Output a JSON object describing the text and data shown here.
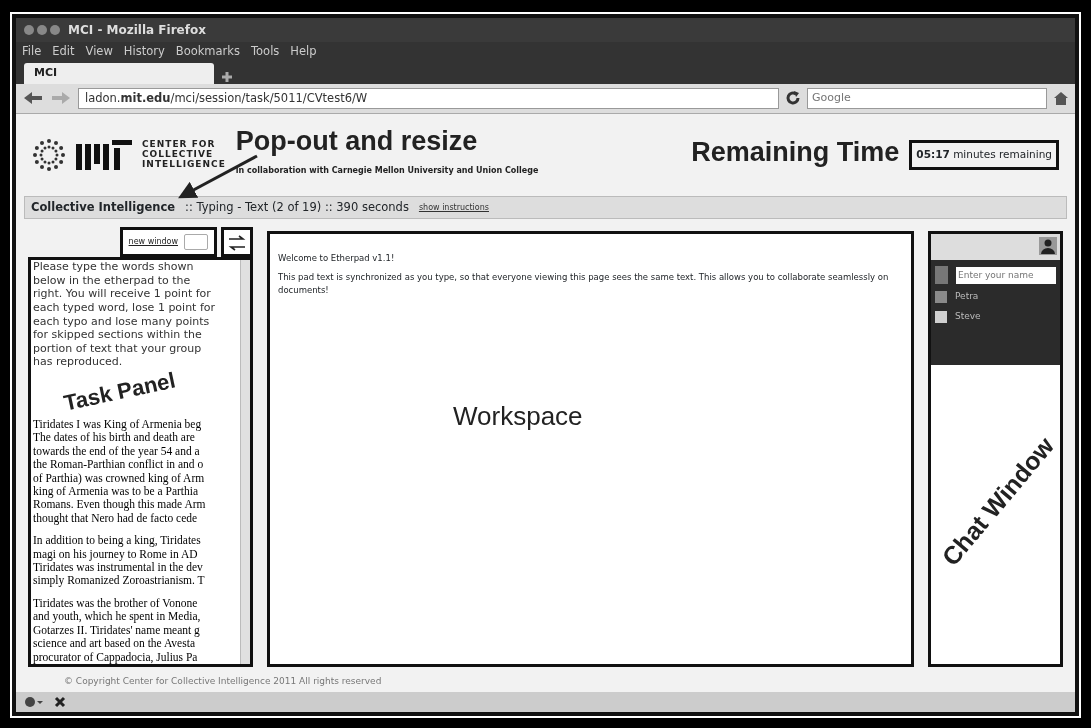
{
  "window": {
    "title": "MCI - Mozilla Firefox"
  },
  "menu": [
    "File",
    "Edit",
    "View",
    "History",
    "Bookmarks",
    "Tools",
    "Help"
  ],
  "tabs": [
    {
      "label": "MCI",
      "selected": true
    }
  ],
  "address_bar": {
    "url": "ladon.**mit.edu**/mci/session/task/5011/CVtest6/W"
  },
  "search": {
    "placeholder": "Google"
  },
  "header": {
    "logo_lines": [
      "CENTER FOR",
      "COLLECTIVE",
      "INTELLIGENCE"
    ],
    "collaboration": "in collaboration with Carnegie Mellon University and Union College",
    "timer": {
      "time": "05:17",
      "label": "minutes remaining"
    }
  },
  "task_bar": {
    "title": "Collective Intelligence",
    "detail": ":: Typing - Text (2 of 19) :: 390 seconds",
    "link": "show instructions"
  },
  "task_panel": {
    "new_window": "new window",
    "instructions": [
      "Please type the words shown",
      "below in the etherpad to the",
      "right. You will receive 1 point for",
      "each typed word, lose 1 point for",
      "each typo and lose many points",
      "for skipped sections within the",
      "portion of text that your group",
      "has reproduced."
    ],
    "paragraphs": [
      [
        "Tiridates I was King of Armenia beg",
        "The dates of his birth and death are",
        "towards the end of the year 54 and a",
        "the Roman-Parthian conflict in and o",
        "of Parthia) was crowned king of Arm",
        "king of Armenia was to be a Parthia",
        "Romans. Even though this made Arm",
        "thought that Nero had de facto cede"
      ],
      [
        "In addition to being a king, Tiridates",
        "magi on his journey to Rome in AD",
        "Tiridates was instrumental in the dev",
        "simply Romanized Zoroastrianism. T"
      ],
      [
        "Tiridates was the brother of Vonone",
        "and youth, which he spent in Media,",
        "Gotarzes II. Tiridates' name meant g",
        "science and art based on the Avesta",
        "procurator of Cappadocia, Julius Pa"
      ]
    ]
  },
  "pad": {
    "lines": [
      "Welcome to Etherpad v1.1!",
      "This pad text is synchronized as you type, so that everyone viewing this page sees the same text.  This allows you to collaborate seamlessly on documents!"
    ]
  },
  "chat": {
    "name_placeholder": "Enter your name",
    "users": [
      {
        "name": "Petra",
        "color": "#8a8a8a"
      },
      {
        "name": "Steve",
        "color": "#d0d0d0"
      }
    ]
  },
  "footer": "© Copyright Center for Collective Intelligence 2011  All rights reserved",
  "annotations": {
    "popout": "Pop-out and resize",
    "remaining_time": "Remaining Time",
    "task_panel": "Task Panel",
    "workspace": "Workspace",
    "chat_window": "Chat Window"
  }
}
